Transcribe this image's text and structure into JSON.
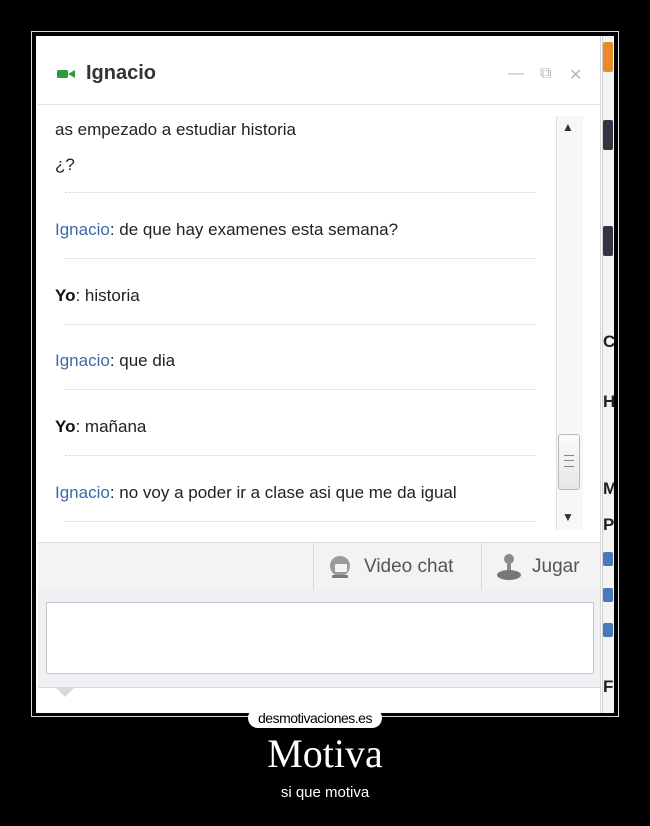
{
  "chat": {
    "title": "Ignacio",
    "controls": {
      "minimize": "—",
      "popout": "⧉",
      "close": "✕"
    },
    "messages": [
      {
        "speaker": "",
        "text": "as empezado a estudiar historia"
      },
      {
        "speaker": "",
        "text": "¿?"
      },
      {
        "speaker": "Ignacio",
        "text": ": de que hay examenes esta semana?"
      },
      {
        "speaker": "Yo",
        "text": ": historia"
      },
      {
        "speaker": "Ignacio",
        "text": ": que dia"
      },
      {
        "speaker": "Yo",
        "text": ": mañana"
      },
      {
        "speaker": "Ignacio",
        "text": ": no voy a poder ir a clase asi que me da igual"
      }
    ],
    "toolbar": {
      "video_chat": "Video chat",
      "play": "Jugar"
    },
    "input": {
      "value": "",
      "placeholder": ""
    }
  },
  "side_fragments": [
    "C",
    "H",
    "M",
    "P",
    "F"
  ],
  "poster": {
    "watermark": "desmotivaciones.es",
    "title": "Motiva",
    "subtitle": "si que motiva"
  },
  "colors": {
    "speaker_ignacio": "#3a6aa8",
    "camera_icon": "#2e9a3b",
    "background": "#000000"
  },
  "icons": [
    "video-camera-icon",
    "minimize-icon",
    "popout-icon",
    "close-icon",
    "scroll-up-icon",
    "scroll-down-icon",
    "webcam-icon",
    "joystick-icon"
  ]
}
